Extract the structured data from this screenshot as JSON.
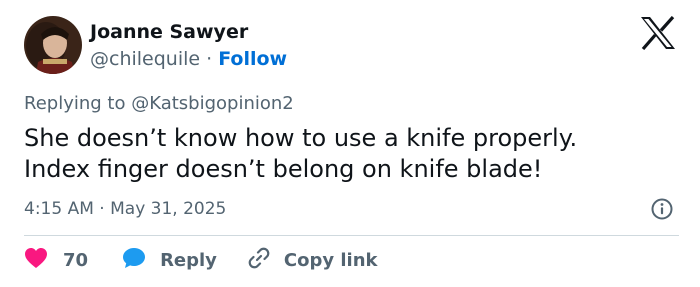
{
  "author": {
    "name": "Joanne Sawyer",
    "handle": "@chilequile",
    "separator": " · ",
    "follow_label": "Follow"
  },
  "platform_icon": "x-logo-icon",
  "reply_context": {
    "prefix": "Replying to ",
    "mention": "@Katsbigopinion2"
  },
  "tweet": {
    "lines": [
      "She doesn’t know how to use a knife properly.",
      "Index finger doesn’t belong on knife blade!"
    ]
  },
  "meta": {
    "time": "4:15 AM",
    "separator": " · ",
    "date": "May 31, 2025"
  },
  "actions": {
    "like_count": "70",
    "reply_label": "Reply",
    "copy_label": "Copy link"
  },
  "icons": {
    "like": "heart-icon",
    "reply": "speech-bubble-icon",
    "copy": "link-icon",
    "info": "info-icon"
  },
  "colors": {
    "heart": "#f91880",
    "bubble": "#1d9bf0",
    "follow": "#006fd6",
    "muted": "#536471",
    "text": "#0f1419",
    "divider": "#cfd9de"
  }
}
